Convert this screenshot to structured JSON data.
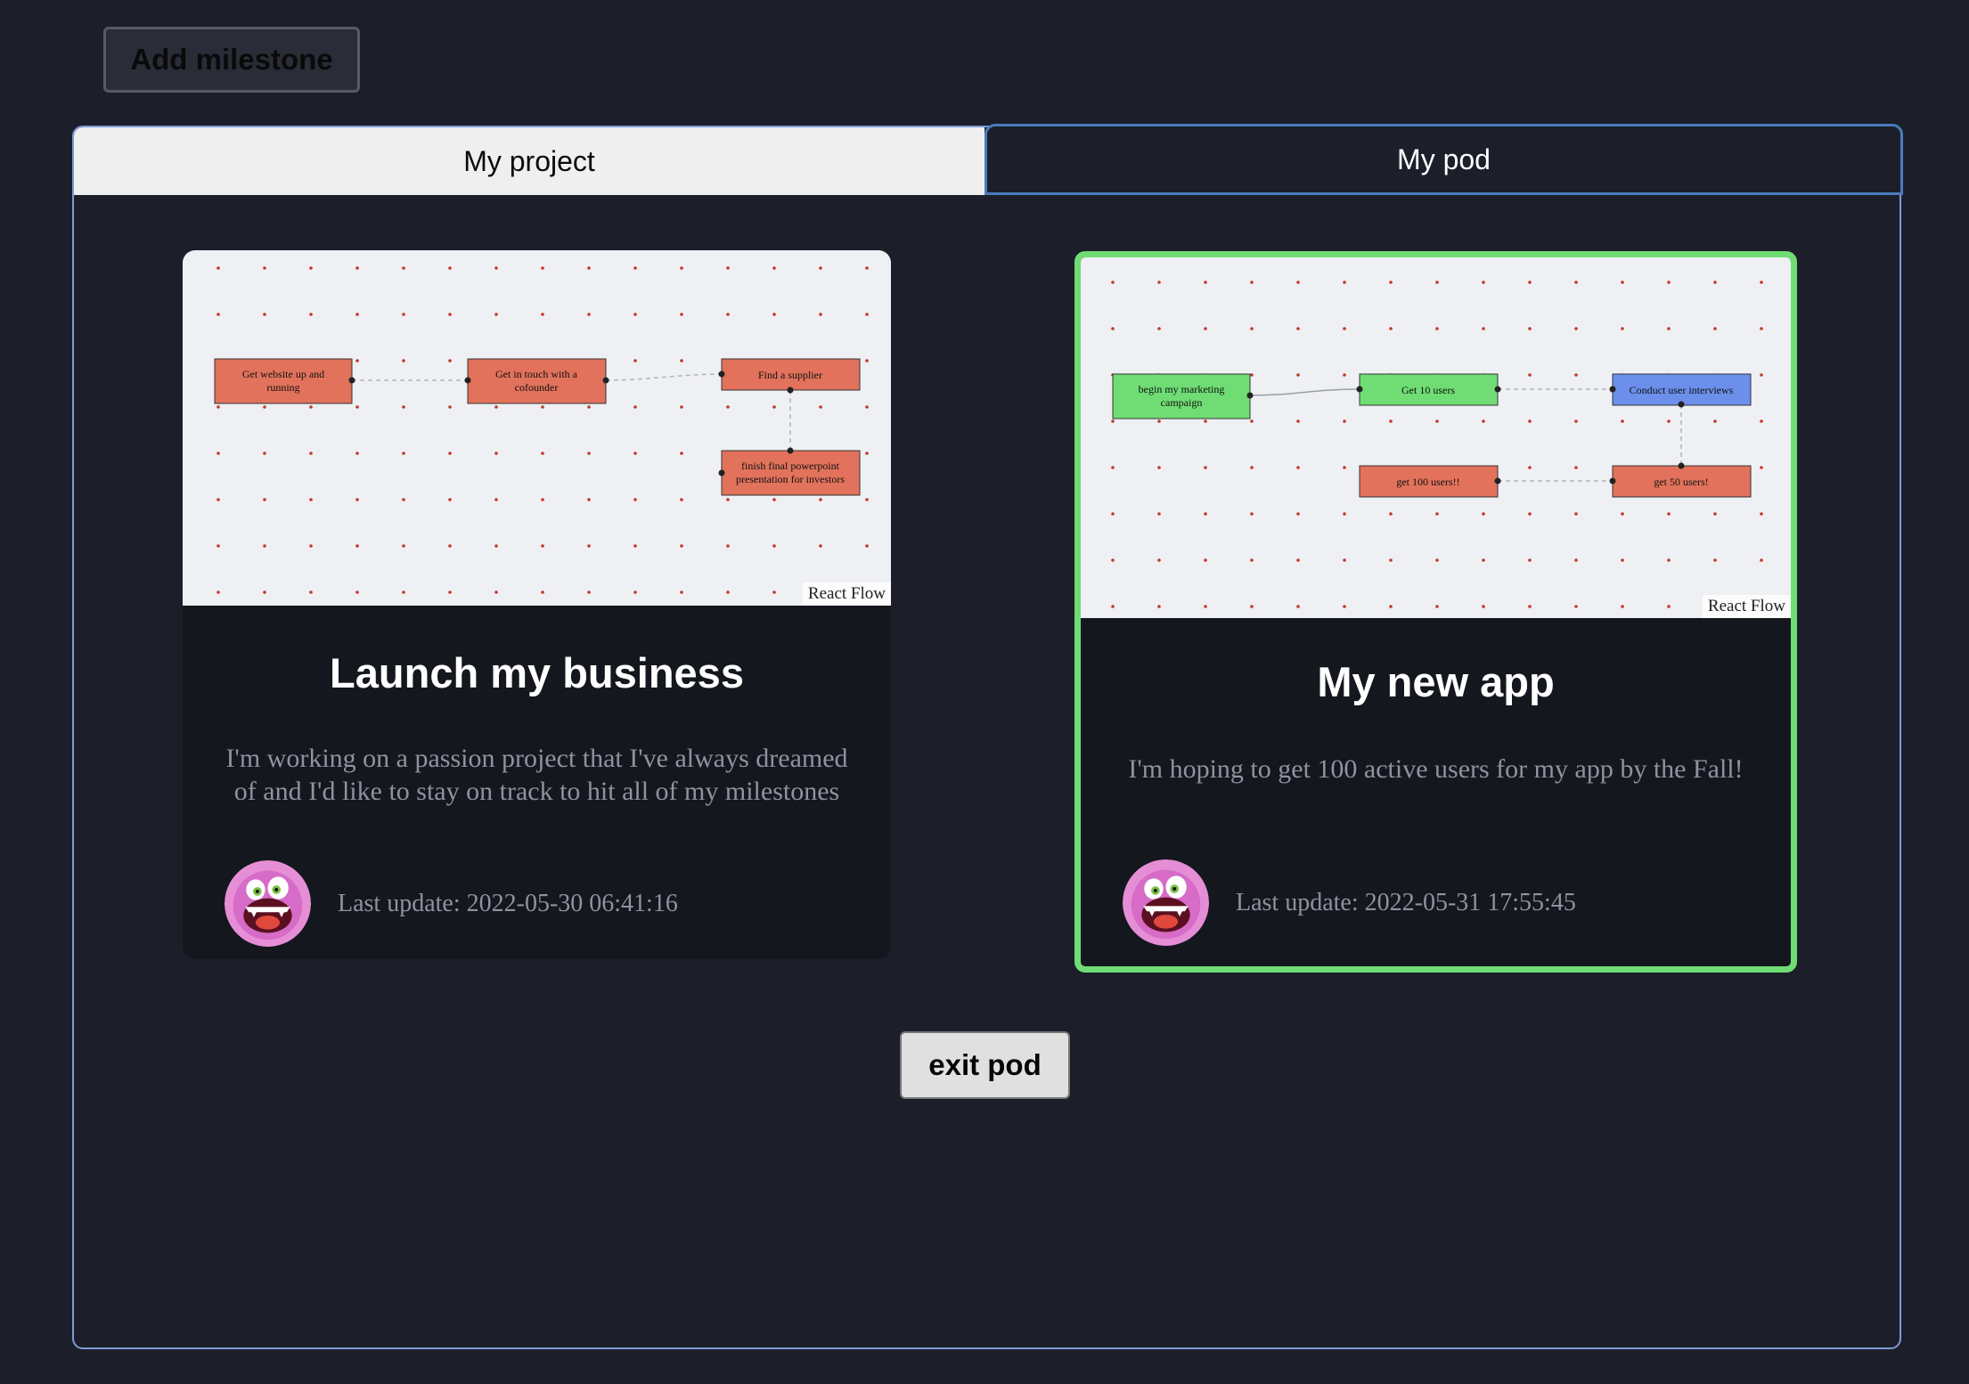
{
  "toolbar": {
    "add_milestone_label": "Add milestone"
  },
  "tabs": [
    {
      "label": "My project",
      "selected": false
    },
    {
      "label": "My pod",
      "selected": true
    }
  ],
  "cards": [
    {
      "title": "Launch my business",
      "description": "I'm working on a passion project that I've always dreamed of and I'd like to stay on track to hit all of my milestones",
      "last_update": "Last update: 2022-05-30 06:41:16",
      "flow_attribution": "React Flow",
      "nodes": [
        {
          "label_lines": [
            "Get website up and",
            "running"
          ],
          "color": "#e2725b"
        },
        {
          "label_lines": [
            "Get in touch with a",
            "cofounder"
          ],
          "color": "#e2725b"
        },
        {
          "label_lines": [
            "Find a supplier"
          ],
          "color": "#e2725b"
        },
        {
          "label_lines": [
            "finish final powerpoint",
            "presentation for investors"
          ],
          "color": "#e2725b"
        }
      ]
    },
    {
      "title": "My new app",
      "description": "I'm hoping to get 100 active users for my app by the Fall!",
      "last_update": "Last update: 2022-05-31 17:55:45",
      "flow_attribution": "React Flow",
      "highlighted": true,
      "highlight_color": "#6fdd74",
      "nodes": [
        {
          "label_lines": [
            "begin my marketing",
            "campaign"
          ],
          "color": "#6fdd74"
        },
        {
          "label_lines": [
            "Get 10 users"
          ],
          "color": "#6fdd74"
        },
        {
          "label_lines": [
            "Conduct user interviews"
          ],
          "color": "#6b8fea"
        },
        {
          "label_lines": [
            "get 100 users!!"
          ],
          "color": "#e2725b"
        },
        {
          "label_lines": [
            "get 50 users!"
          ],
          "color": "#e2725b"
        }
      ]
    }
  ],
  "footer": {
    "exit_pod_label": "exit pod"
  },
  "colors": {
    "background": "#1c1f29",
    "panel_border": "#7d9ad6",
    "dot_color": "#c0392b"
  }
}
